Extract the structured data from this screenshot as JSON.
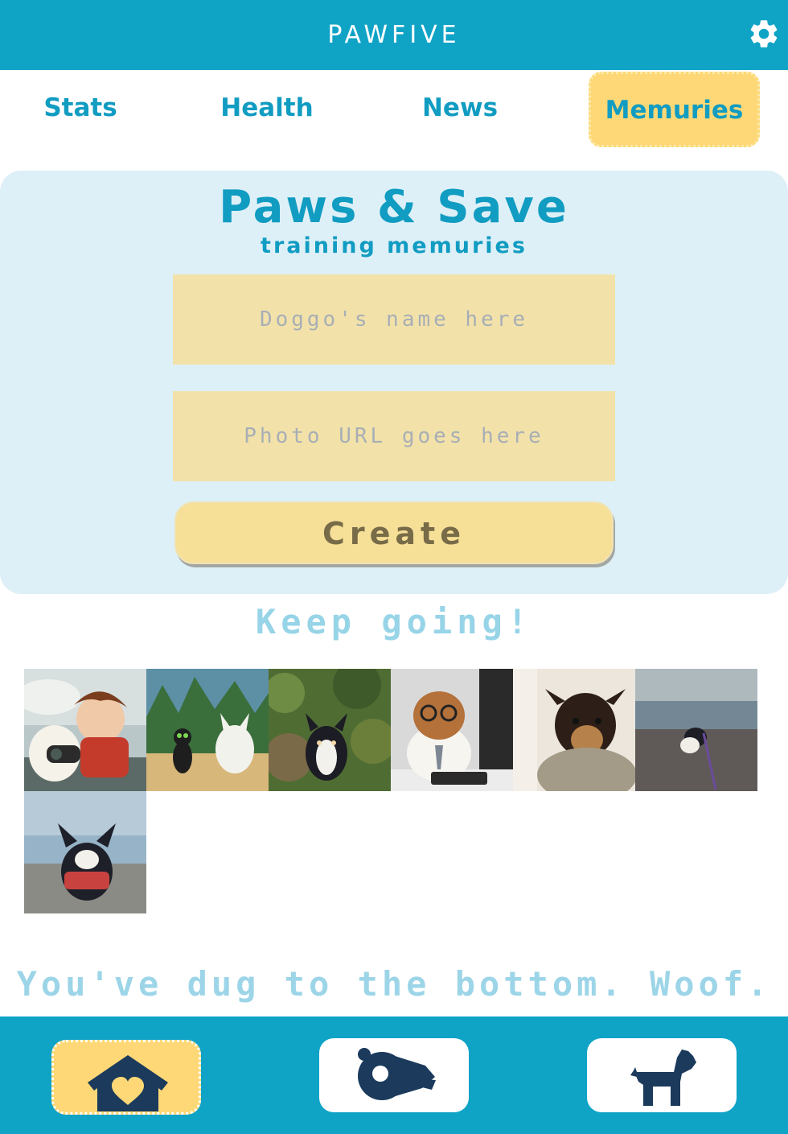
{
  "app": {
    "title": "PAWFIVE"
  },
  "tabs": [
    {
      "label": "Stats",
      "active": false
    },
    {
      "label": "Health",
      "active": false
    },
    {
      "label": "News",
      "active": false
    },
    {
      "label": "Memuries",
      "active": true
    }
  ],
  "form": {
    "title": "Paws & Save",
    "subtitle": "training memuries",
    "name_placeholder": "Doggo's name here",
    "url_placeholder": "Photo URL goes here",
    "create_label": "Create"
  },
  "gallery": {
    "heading": "Keep going!",
    "photos": [
      {
        "subject": "animated dog and boy with goggles"
      },
      {
        "subject": "animated cat and white dog in a forest"
      },
      {
        "subject": "corgi in leafy bushes"
      },
      {
        "subject": "small dog with glasses and tie at a keyboard"
      },
      {
        "subject": "black and tan dog wrapped in a scarf"
      },
      {
        "subject": "corgi on a pebble beach"
      },
      {
        "subject": "smiling corgi with red bandana at the seaside"
      }
    ],
    "footer_message": "You've dug to the bottom. Woof."
  },
  "bottom_nav": [
    {
      "icon": "home-heart-icon",
      "active": true
    },
    {
      "icon": "whistle-icon",
      "active": false
    },
    {
      "icon": "dog-icon",
      "active": false
    }
  ],
  "colors": {
    "primary": "#0fa3c6",
    "accent": "#fed876",
    "panel": "#def0f7",
    "input": "#f2e2a9",
    "navy": "#1b3a5c"
  }
}
